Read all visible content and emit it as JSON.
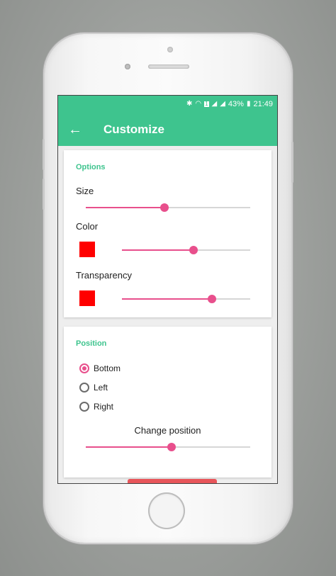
{
  "status_bar": {
    "icons": [
      "bluetooth-icon",
      "wifi-icon",
      "sim-icon",
      "signal-icon",
      "signal-icon",
      "battery-icon"
    ],
    "battery": "43%",
    "time": "21:49"
  },
  "app_bar": {
    "back_icon": "arrow-back-icon",
    "title": "Customize"
  },
  "options": {
    "section_title": "Options",
    "size": {
      "label": "Size",
      "value": 0.48
    },
    "color": {
      "label": "Color",
      "swatch": "#ff0000",
      "value": 0.56
    },
    "transparency": {
      "label": "Transparency",
      "swatch": "#ff0000",
      "value": 0.7
    }
  },
  "position": {
    "section_title": "Position",
    "options": [
      {
        "label": "Bottom",
        "selected": true
      },
      {
        "label": "Left",
        "selected": false
      },
      {
        "label": "Right",
        "selected": false
      }
    ],
    "change_label": "Change position",
    "change_value": 0.52
  },
  "colors": {
    "accent": "#3ec48e",
    "slider": "#e84f8c"
  }
}
